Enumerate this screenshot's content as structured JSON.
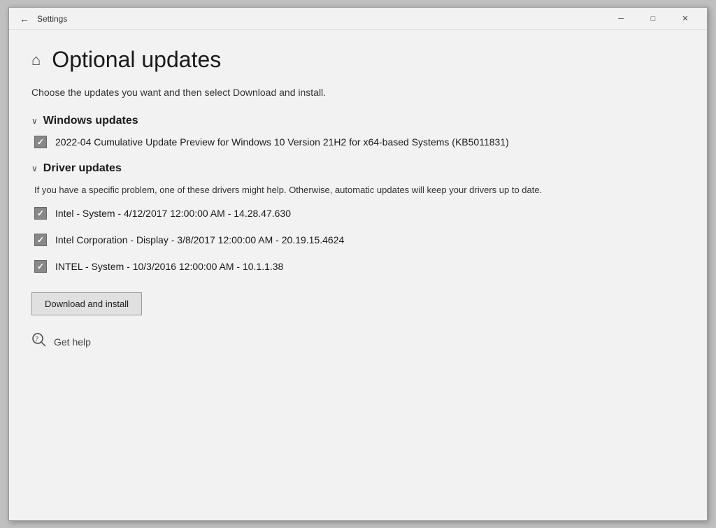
{
  "titlebar": {
    "title": "Settings",
    "minimize_label": "─",
    "maximize_label": "□",
    "close_label": "✕"
  },
  "page": {
    "home_icon": "⌂",
    "title": "Optional updates",
    "subtitle": "Choose the updates you want and then select Download and install."
  },
  "windows_updates": {
    "section_title": "Windows updates",
    "chevron": "∨",
    "items": [
      {
        "label": "2022-04 Cumulative Update Preview for Windows 10 Version 21H2 for x64-based Systems (KB5011831)",
        "checked": true
      }
    ]
  },
  "driver_updates": {
    "section_title": "Driver updates",
    "chevron": "∨",
    "note": "If you have a specific problem, one of these drivers might help. Otherwise, automatic updates will keep your drivers up to date.",
    "items": [
      {
        "label": "Intel - System - 4/12/2017 12:00:00 AM - 14.28.47.630",
        "checked": true
      },
      {
        "label": "Intel Corporation - Display - 3/8/2017 12:00:00 AM - 20.19.15.4624",
        "checked": true
      },
      {
        "label": "INTEL - System - 10/3/2016 12:00:00 AM - 10.1.1.38",
        "checked": true
      }
    ]
  },
  "actions": {
    "download_button": "Download and install"
  },
  "footer": {
    "get_help_icon": "🔍",
    "get_help_label": "Get help"
  }
}
